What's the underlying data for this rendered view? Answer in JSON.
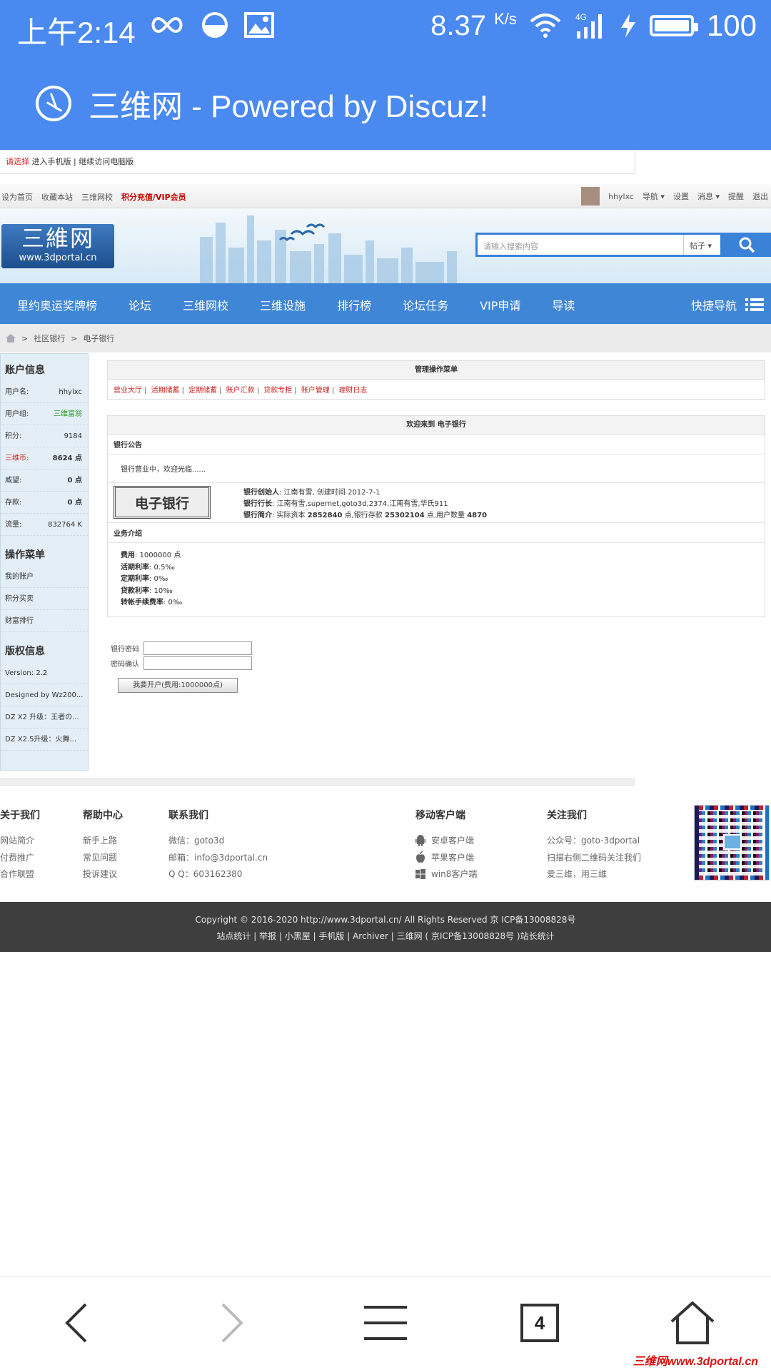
{
  "status": {
    "time": "上午2:14",
    "speed": "8.37",
    "speed_unit": "K/s",
    "network": "4G",
    "battery": "100"
  },
  "app": {
    "title": "三维网 - Powered by Discuz!"
  },
  "notice": {
    "prefix": "请选择",
    "text": " 进入手机版 | 继续访问电脑版"
  },
  "topbar": {
    "left": [
      "设为首页",
      "收藏本站",
      "三维网校"
    ],
    "vip": "积分充值/VIP会员",
    "username": "hhylxc",
    "right": [
      "导航",
      "设置",
      "消息",
      "提醒",
      "退出"
    ]
  },
  "header": {
    "logo_cn": "三維网",
    "logo_url": "www.3dportal.cn",
    "search_placeholder": "请输入搜索内容",
    "search_type": "帖子"
  },
  "nav": {
    "items": [
      "里约奥运奖牌榜",
      "论坛",
      "三维网校",
      "三维设施",
      "排行榜",
      "论坛任务",
      "VIP申请",
      "导读"
    ],
    "quick": "快捷导航"
  },
  "breadcrumb": [
    "社区银行",
    "电子银行"
  ],
  "sidebar": {
    "account_title": "账户信息",
    "account": [
      {
        "label": "用户名:",
        "value": "hhylxc"
      },
      {
        "label": "用户组:",
        "value": "三维富翁"
      },
      {
        "label": "积分:",
        "value": "9184"
      },
      {
        "label": "三维币:",
        "value": "8624 点"
      },
      {
        "label": "威望:",
        "value": "0 点"
      },
      {
        "label": "存款:",
        "value": "0 点"
      },
      {
        "label": "流量:",
        "value": "832764 K"
      }
    ],
    "menu_title": "操作菜单",
    "menu": [
      "我的账户",
      "积分买卖",
      "财富排行"
    ],
    "copyright_title": "版权信息",
    "copyright": [
      "Version: 2.2",
      "Designed by Wz200...",
      "DZ X2 升级：王者の...",
      "DZ X2.5升级：火舞..."
    ]
  },
  "admin_menu": {
    "title": "管理操作菜单",
    "links": [
      "营业大厅",
      "活期储蓄",
      "定期储蓄",
      "账户汇款",
      "贷款专柜",
      "账户管理",
      "理财日志"
    ]
  },
  "bank": {
    "welcome": "欢迎来到 电子银行",
    "notice_title": "银行公告",
    "notice_text": "银行营业中，欢迎光临......",
    "logo_text": "电子银行",
    "founder_label": "银行创始人",
    "founder_value": ": 江南有雪, 创建时间 2012-7-1",
    "head_label": "银行行长",
    "head_value": ": 江南有雪,supernet,goto3d,2374,江南有雪,华氏911",
    "intro_label": "银行简介",
    "intro_pre": ": 实际资本 ",
    "capital": "2852840",
    "intro_mid": " 点,银行存款 ",
    "deposit": "25302104",
    "intro_mid2": " 点,用户数量 ",
    "users": "4870",
    "business_title": "业务介绍",
    "business": [
      {
        "label": "费用",
        "value": ": 1000000 点"
      },
      {
        "label": "活期利率",
        "value": ": 0.5‰"
      },
      {
        "label": "定期利率",
        "value": ": 0‰"
      },
      {
        "label": "贷款利率",
        "value": ": 10‰"
      },
      {
        "label": "转帐手续费率",
        "value": ": 0‰"
      }
    ]
  },
  "form": {
    "password_label": "银行密码",
    "confirm_label": "密码确认",
    "submit": "我要开户(费用:1000000点)"
  },
  "footer": {
    "about_title": "关于我们",
    "about": [
      "网站简介",
      "付费推广",
      "合作联盟"
    ],
    "help_title": "帮助中心",
    "help": [
      "新手上路",
      "常见问题",
      "投诉建议"
    ],
    "contact_title": "联系我们",
    "contact": [
      "微信：goto3d",
      "邮箱：info@3dportal.cn",
      "Q  Q：603162380"
    ],
    "mobile_title": "移动客户端",
    "mobile": [
      "安卓客户端",
      "苹果客户端",
      "win8客户端"
    ],
    "follow_title": "关注我们",
    "follow": [
      "公众号：goto-3dportal",
      "扫描右侧二维码关注我们",
      "爱三维，用三维"
    ]
  },
  "copyright": {
    "line1": "Copyright © 2016-2020 http://www.3dportal.cn/ All Rights Reserved 京 ICP备13008828号",
    "line2": "站点统计 | 举报 | 小黑屋 | 手机版 | Archiver | 三维网 ( 京ICP备13008828号 )站长统计"
  },
  "browser": {
    "tab_count": "4"
  },
  "watermark": "三维网www.3dportal.cn"
}
